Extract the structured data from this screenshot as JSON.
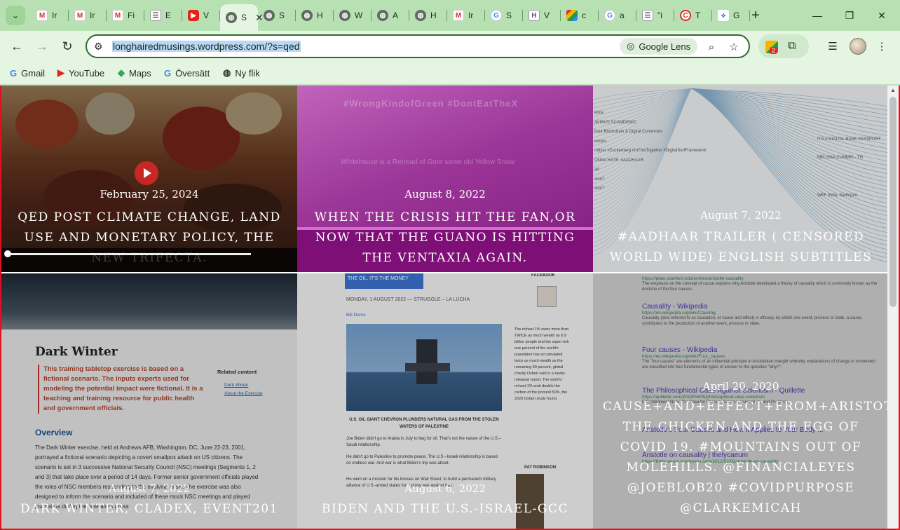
{
  "browser": {
    "tabs": [
      {
        "label": "Ir",
        "icon": "gmail"
      },
      {
        "label": "Ir",
        "icon": "gmail"
      },
      {
        "label": "Fi",
        "icon": "gmail"
      },
      {
        "label": "E",
        "icon": "news"
      },
      {
        "label": "V",
        "icon": "youtube"
      },
      {
        "label": "S",
        "icon": "globe",
        "active": true
      },
      {
        "label": "S",
        "icon": "globe"
      },
      {
        "label": "H",
        "icon": "globe"
      },
      {
        "label": "W",
        "icon": "globe"
      },
      {
        "label": "A",
        "icon": "globe"
      },
      {
        "label": "H",
        "icon": "globe"
      },
      {
        "label": "Ir",
        "icon": "gmail"
      },
      {
        "label": "S",
        "icon": "google"
      },
      {
        "label": "V",
        "icon": "hfow"
      },
      {
        "label": "c",
        "icon": "image"
      },
      {
        "label": "a",
        "icon": "google"
      },
      {
        "label": "\"i",
        "icon": "news"
      },
      {
        "label": "T",
        "icon": "red-circle"
      },
      {
        "label": "G",
        "icon": "connect"
      }
    ],
    "address": "longhairedmusings.wordpress.com/?s=qed",
    "lens_label": "Google Lens",
    "extension_badge": "2",
    "bookmarks": [
      {
        "label": "Gmail",
        "icon": "google-icon"
      },
      {
        "label": "YouTube",
        "icon": "youtube-icon"
      },
      {
        "label": "Maps",
        "icon": "maps-icon"
      },
      {
        "label": "Översätt",
        "icon": "translate-icon"
      },
      {
        "label": "Ny flik",
        "icon": "globe-icon"
      }
    ]
  },
  "posts": [
    {
      "date": "February 25, 2024",
      "title": "QED POST CLIMATE CHANGE, LAND USE AND MONETARY POLICY, THE NEW TRIFECTA."
    },
    {
      "date": "August 8, 2022",
      "title": "WHEN THE CRISIS HIT THE FAN,OR NOW THAT THE GUANO IS HITTING THE VENTAXIA AGAIN."
    },
    {
      "date": "August 7, 2022",
      "title": "#AADHAAR TRAILER ( CENSORED WORLD WIDE) ENGLISH SUBTITLES"
    },
    {
      "date": "August 7, 2022",
      "title": "DARK WINTER, CLADEX, EVENT201"
    },
    {
      "date": "August 6, 2022",
      "title": "BIDEN AND THE U.S.-ISRAEL-GCC"
    },
    {
      "date": "April 20, 2020",
      "title": "CAUSE+AND+EFFECT+FROM+ARISTOTLE+TO+SCIENTISM. THE CHICKEN AND THE EGG OF COVID 19. #MOUNTAINS OUT OF MOLEHILLS. @FINANCIALEYES @JOEBLOB20 #COVIDPURPOSE @CLARKEMICAH"
    }
  ],
  "thumb1": {
    "hashtag": "#WrongKindofGreen #DontEatTheX",
    "overlay_text": "Whitehouse is a Retread of Gore same old Yellow Snow"
  },
  "thumb2": {
    "rows": [
      "ence",
      "AVIRUS SCAMDEMIC",
      "bout Blockchain & Digital Currencies",
      "encies",
      "mdyar #Zuckerberg #InThisTogether #DigitalSerfFramework",
      "ONNA HATE. #AADHAAR",
      "ad",
      "sion?",
      "sion?"
    ],
    "right_rows": [
      "ITS A DIGITAL BANK PASSPORT",
      "MELISSA CUMMEI - TH",
      "WEF India, Sadhguru"
    ]
  },
  "thumb3": {
    "heading": "Dark Winter",
    "note": "This training tabletop exercise is based on a fictional scenario. The inputs experts used for modeling the potential impact were fictional. It is a teaching and training resource for public health and government officials.",
    "related_title": "Related content",
    "related_links": [
      "Dark Winter",
      "About the Exercise"
    ],
    "overview": "Overview",
    "body": "The Dark Winter exercise, held at Andrews AFB, Washington, DC, June 22-23, 2001, portrayed a fictional scenario depicting a covert smallpox attack on US citizens. The scenario is set in 3 successive National Security Council (NSC) meetings (Segments 1, 2 and 3) that take place over a period of 14 days. Former senior government officials played the roles of NSC members responding to the evolving crisis. The exercise was also designed to inform the scenario and included of these mock NSC meetings and played journalists during the scenario's press"
  },
  "thumb4": {
    "headline": "THE OIL, IT'S THE MONEY",
    "meta": "MONDAY, 1 AUGUST 2022 — STRUGGLE – LA LUCHA",
    "author": "Bill Dores",
    "caption": "U.S. OIL GIANT CHEVRON PLUNDERS NATURAL GAS FROM THE STOLEN WATERS OF PALESTINE",
    "p1": "Joe Biden didn't go to Arabia in July to beg for oil. That's not the nature of the U.S.–Saudi relationship.",
    "p2": "He didn't go to Palestine to promote peace. The U.S.–Israeli relationship is based on endless war. And war is what Biden's trip was about.",
    "p3": "He went on a mission for his bosses on Wall Street: to build a permanent military alliance of U.S.-armed states for a proxy war against Iran.",
    "side": "The richest 1% owns more than TWICE as much wealth as 6.9 billion people and the super-rich one percent of the world's population has accumulated twice as much wealth as the remaining 90 percent, global charity Oxfam said in a newly-released report. The world's richest 1% emit double the carbon of the poorest 50%, the 2020 Oxfam study found.",
    "facebook": "FACEBOOK",
    "pat": "PAT ROBINSON"
  },
  "thumb5": {
    "results": [
      {
        "title": "",
        "url": "https://plato.stanford.edu/entries/aristotle-causality",
        "snippet": "The emphasis on the concept of cause explains why Aristotle developed a theory of causality which is commonly known as the doctrine of the four causes."
      },
      {
        "title": "Causality - Wikipedia",
        "url": "https://en.wikipedia.org/wiki/Causing",
        "snippet": "Causality (also referred to as causation, or cause and effect) is efficacy, by which one event, process or state, a cause, contributes to the production of another event, process or state."
      },
      {
        "title": "Four causes - Wikipedia",
        "url": "https://en.wikipedia.org/wiki/Four_causes",
        "snippet": "The \"four causes\" are elements of an influential principle in Aristotelian thought whereby explanations of change or movement are classified into four fundamental types of answer to the question \"why?\"."
      },
      {
        "title": "The Philosophical Case Against Scientism - Quillette",
        "url": "https://quillette.com/2018/04/05/philosophical-case-scientism",
        "snippet": "Enlightenment Now: The Case for Reason, Science, Humanism, and Progress."
      },
      {
        "title": "Aristotle's Four Causes and How it Applies to Your Body ...",
        "url": "",
        "snippet": ""
      },
      {
        "title": "Aristotle on causality | thelycaeum",
        "url": "https://thelycaeum.wordpress.com/2012/02/02/aristotle-on-causality",
        "snippet": ""
      }
    ]
  }
}
